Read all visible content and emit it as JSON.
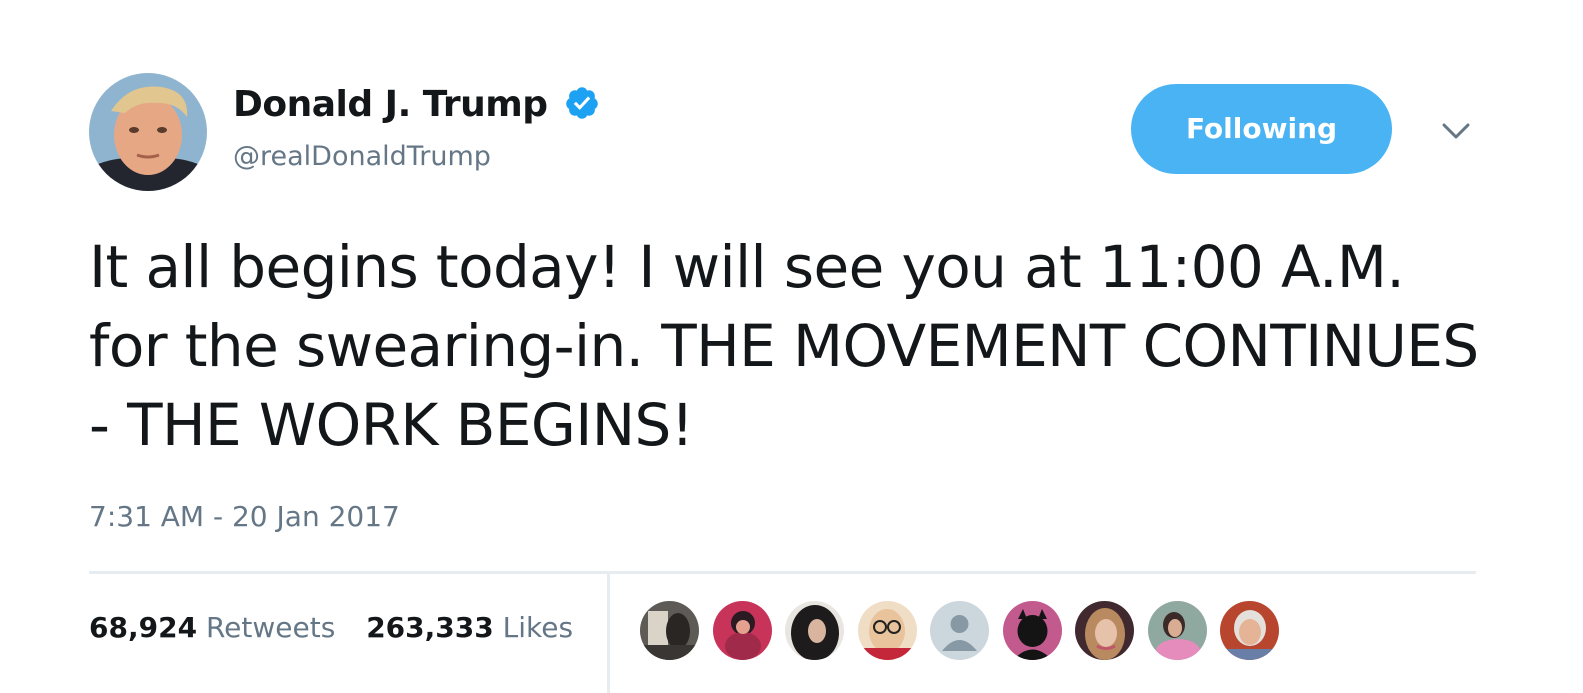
{
  "user": {
    "display_name": "Donald J. Trump",
    "handle": "@realDonaldTrump",
    "verified_icon": "verified-badge-icon",
    "verified_color": "#1da1f2"
  },
  "follow_button": {
    "label": "Following",
    "color": "#4ab3f4"
  },
  "menu": {
    "icon": "chevron-down-icon"
  },
  "tweet": {
    "text": "It all begins today! I will see you at 11:00 A.M. for the swearing-in. THE MOVEMENT CONTINUES - THE WORK BEGINS!",
    "timestamp": "7:31 AM - 20 Jan 2017"
  },
  "stats": {
    "retweets_count": "68,924",
    "retweets_label": "Retweets",
    "likes_count": "263,333",
    "likes_label": "Likes"
  },
  "likers": [
    {
      "icon": "liker-avatar-1"
    },
    {
      "icon": "liker-avatar-2"
    },
    {
      "icon": "liker-avatar-3"
    },
    {
      "icon": "liker-avatar-4"
    },
    {
      "icon": "default-user-icon"
    },
    {
      "icon": "liker-avatar-6"
    },
    {
      "icon": "liker-avatar-7"
    },
    {
      "icon": "liker-avatar-8"
    },
    {
      "icon": "liker-avatar-9"
    }
  ]
}
